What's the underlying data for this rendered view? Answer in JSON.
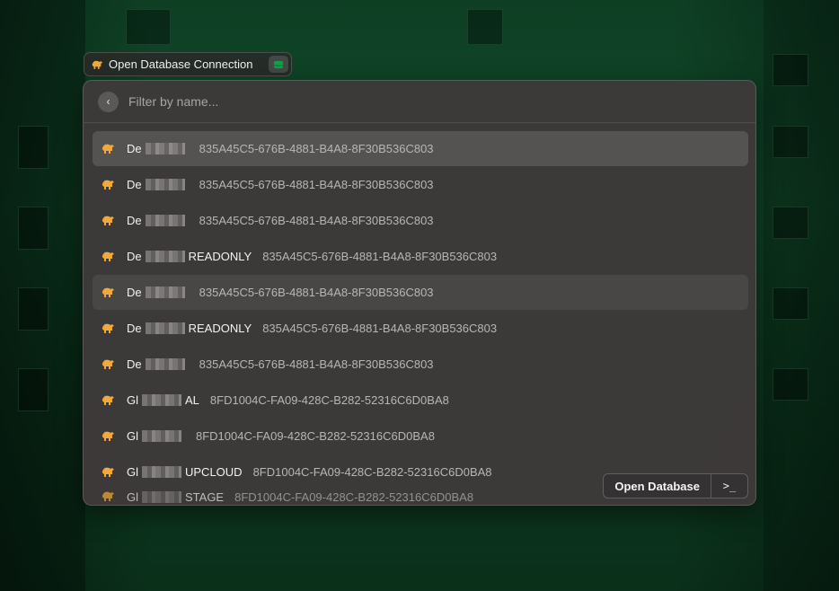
{
  "pill": {
    "title": "Open Database Connection"
  },
  "search": {
    "placeholder": "Filter by name..."
  },
  "rows": [
    {
      "prefix": "De",
      "suffix": "",
      "uuid": "835A45C5-676B-4881-B4A8-8F30B536C803",
      "state": "selected"
    },
    {
      "prefix": "De",
      "suffix": "",
      "uuid": "835A45C5-676B-4881-B4A8-8F30B536C803",
      "state": ""
    },
    {
      "prefix": "De",
      "suffix": "",
      "uuid": "835A45C5-676B-4881-B4A8-8F30B536C803",
      "state": ""
    },
    {
      "prefix": "De",
      "suffix": "READONLY",
      "uuid": "835A45C5-676B-4881-B4A8-8F30B536C803",
      "state": ""
    },
    {
      "prefix": "De",
      "suffix": "",
      "uuid": "835A45C5-676B-4881-B4A8-8F30B536C803",
      "state": "hover"
    },
    {
      "prefix": "De",
      "suffix": "READONLY",
      "uuid": "835A45C5-676B-4881-B4A8-8F30B536C803",
      "state": ""
    },
    {
      "prefix": "De",
      "suffix": "",
      "uuid": "835A45C5-676B-4881-B4A8-8F30B536C803",
      "state": ""
    },
    {
      "prefix": "Gl",
      "suffix": "AL",
      "uuid": "8FD1004C-FA09-428C-B282-52316C6D0BA8",
      "state": ""
    },
    {
      "prefix": "Gl",
      "suffix": "",
      "uuid": "8FD1004C-FA09-428C-B282-52316C6D0BA8",
      "state": ""
    },
    {
      "prefix": "Gl",
      "suffix": "UPCLOUD",
      "uuid": "8FD1004C-FA09-428C-B282-52316C6D0BA8",
      "state": ""
    },
    {
      "prefix": "Gl",
      "suffix": "STAGE",
      "uuid": "8FD1004C-FA09-428C-B282-52316C6D0BA8",
      "state": "partial"
    }
  ],
  "actions": {
    "open_label": "Open Database",
    "terminal_label": ">_"
  },
  "icons": {
    "row_icon": "elephant-icon",
    "db_icon": "database-icon",
    "back_icon": "chevron-left-icon"
  },
  "colors": {
    "elephant": "#f2a93b",
    "accent_green": "#10a34a"
  }
}
